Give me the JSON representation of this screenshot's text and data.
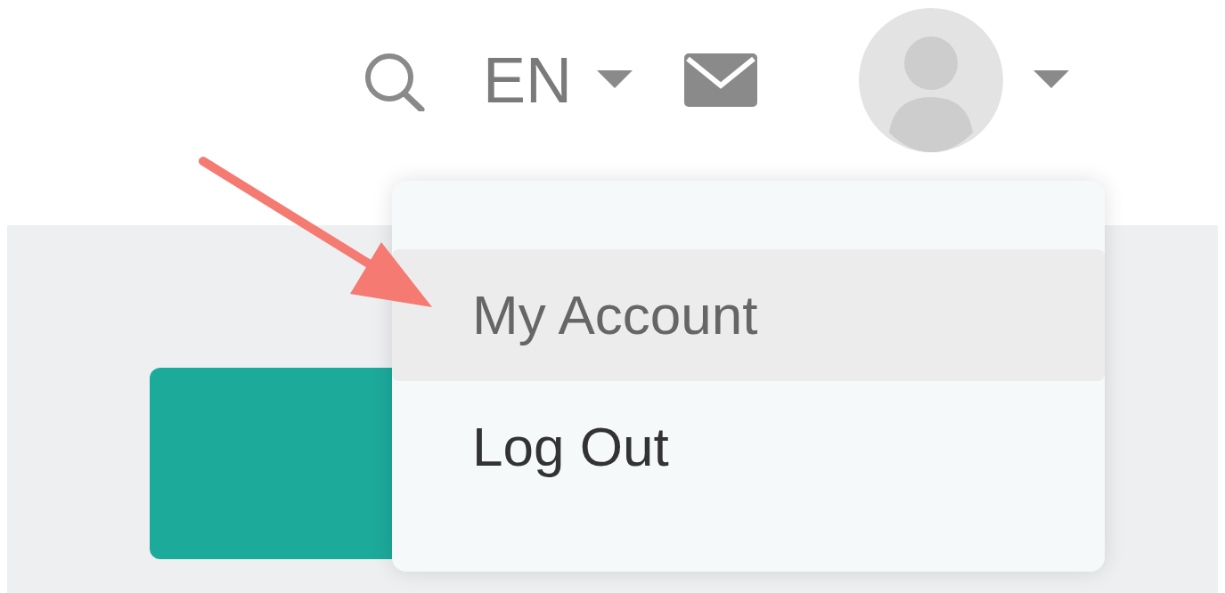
{
  "header": {
    "language": "EN"
  },
  "user_menu": {
    "items": [
      {
        "label": "My Account",
        "selected": true
      },
      {
        "label": "Log Out",
        "selected": false
      }
    ]
  }
}
